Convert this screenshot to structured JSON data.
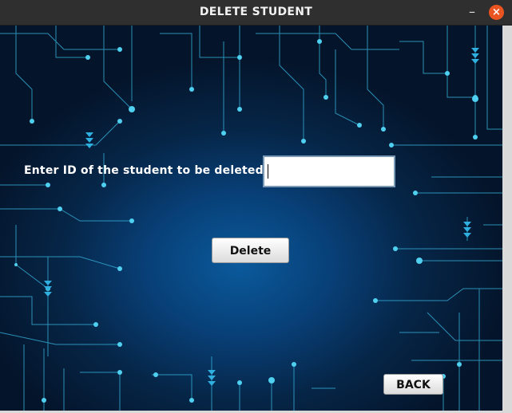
{
  "window": {
    "title": "DELETE STUDENT",
    "minimize_glyph": "–",
    "close_glyph": "×"
  },
  "form": {
    "prompt_label": "Enter ID of the student to be deleted:",
    "id_value": "",
    "delete_label": "Delete",
    "back_label": "BACK"
  },
  "colors": {
    "accent_close": "#e95420",
    "circuit_line": "#37b8e0",
    "background_dark": "#04142a"
  }
}
